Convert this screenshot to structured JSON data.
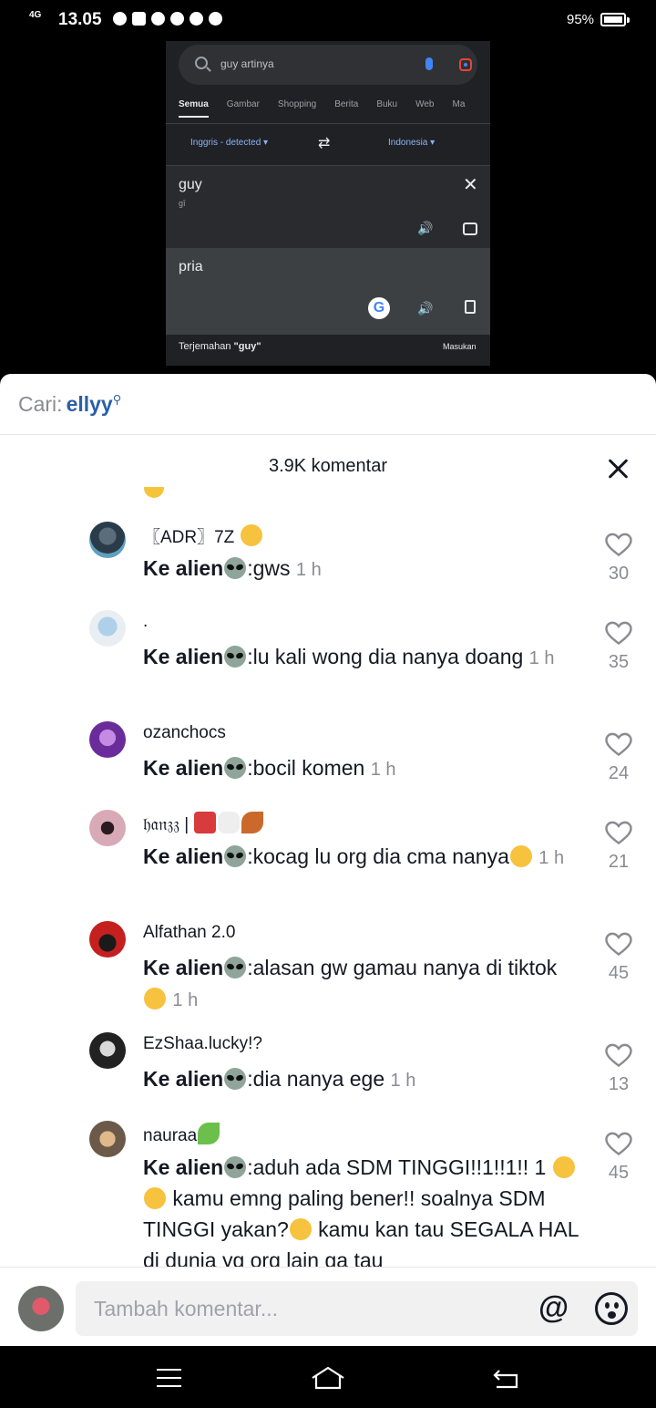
{
  "status_bar": {
    "network": "4G",
    "time": "13.05",
    "battery_percent": "95%"
  },
  "video": {
    "search_query": "guy artinya",
    "tabs": [
      "Semua",
      "Gambar",
      "Shopping",
      "Berita",
      "Buku",
      "Web",
      "Ma"
    ],
    "source_lang": "Inggris - detected",
    "target_lang": "Indonesia",
    "source_text": "guy",
    "source_phonetic": "gī",
    "target_text": "pria",
    "footer_prefix": "Terjemahan ",
    "footer_term": "\"guy\"",
    "footer_right": "Masukan"
  },
  "search_suggestion": {
    "prefix": "Cari:",
    "term": "ellyy"
  },
  "comments_header": {
    "title": "3.9K komentar"
  },
  "comments": [
    {
      "username": "〖ADR〗7Z",
      "reply_to": "Ke alien",
      "text": ":gws",
      "time": "1 h",
      "likes": "30",
      "user_emojis": [
        "yum"
      ]
    },
    {
      "username": ".",
      "reply_to": "Ke alien",
      "text": ":lu kali wong dia nanya doang",
      "time": "1 h",
      "likes": "35"
    },
    {
      "username": "ozanchocs",
      "reply_to": "Ke alien",
      "text": ":bocil komen",
      "time": "1 h",
      "likes": "24"
    },
    {
      "username": "𝔥𝔞𝔫𝔷𝔷 |",
      "reply_to": "Ke alien",
      "text": ":kocag lu org dia cma nanya",
      "time": "1 h",
      "likes": "21"
    },
    {
      "username": "Alfathan 2.0",
      "reply_to": "Ke alien",
      "text": ":alasan gw gamau nanya di tiktok",
      "time": "1 h",
      "likes": "45"
    },
    {
      "username": "EzShaa.lucky!?",
      "reply_to": "Ke alien",
      "text": ":dia nanya ege",
      "time": "1 h",
      "likes": "13"
    },
    {
      "username": "nauraa",
      "reply_to": "Ke alien",
      "text": ":aduh ada SDM TINGGI!!1!!1!! 1",
      "text2": " kamu emng paling bener!! soalnya SDM TINGGI yakan?",
      "text3": " kamu kan tau SEGALA HAL di dunia yg org lain ga tau",
      "likes": "45"
    }
  ],
  "input": {
    "placeholder": "Tambah komentar...",
    "at_label": "@"
  },
  "colors": {
    "link_blue": "#2b5fa6",
    "text_primary": "#161823",
    "text_secondary": "#8a8b91"
  }
}
